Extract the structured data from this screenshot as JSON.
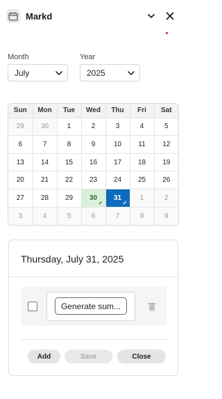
{
  "header": {
    "title": "Markd",
    "icons": {
      "app": "calendar-icon",
      "collapse": "chevron-down-icon",
      "close": "close-icon"
    },
    "notification_dot_color": "#e81123"
  },
  "filters": {
    "month_label": "Month",
    "month_value": "July",
    "year_label": "Year",
    "year_value": "2025"
  },
  "calendar": {
    "weekdays": [
      "Sun",
      "Mon",
      "Tue",
      "Wed",
      "Thu",
      "Fri",
      "Sat"
    ],
    "weeks": [
      [
        "29",
        "30",
        "1",
        "2",
        "3",
        "4",
        "5"
      ],
      [
        "6",
        "7",
        "8",
        "9",
        "10",
        "11",
        "12"
      ],
      [
        "13",
        "14",
        "15",
        "16",
        "17",
        "18",
        "19"
      ],
      [
        "20",
        "21",
        "22",
        "23",
        "24",
        "25",
        "26"
      ],
      [
        "27",
        "28",
        "29",
        "30",
        "31",
        "1",
        "2"
      ],
      [
        "3",
        "4",
        "5",
        "6",
        "7",
        "8",
        "9"
      ]
    ],
    "marked_day": "30",
    "selected_day": "31",
    "colors": {
      "marked": "#d9f0dc",
      "selected": "#0f6cbd"
    }
  },
  "day_panel": {
    "title": "Thursday, July 31, 2025",
    "items": [
      {
        "text": "Generate sum...",
        "checked": false
      }
    ],
    "actions": {
      "add": "Add",
      "save": "Save",
      "close": "Close"
    }
  }
}
